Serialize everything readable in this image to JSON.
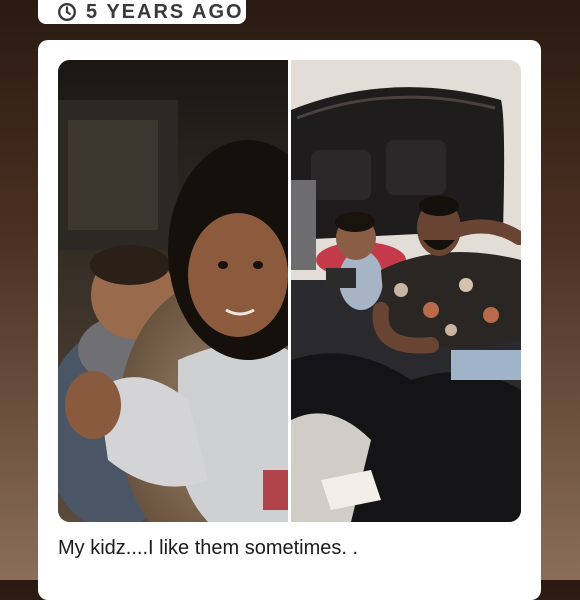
{
  "memory_banner": {
    "label": "5 YEARS AGO",
    "icon": "history-icon"
  },
  "post": {
    "photos": [
      {
        "name": "photo-left"
      },
      {
        "name": "photo-right"
      }
    ],
    "caption": "My kidz....I like them sometimes. ."
  },
  "colors": {
    "background_top": "#2a1a12",
    "background_bottom": "#8a6e5a",
    "card": "#ffffff",
    "caption_text": "#1c1c1c"
  }
}
